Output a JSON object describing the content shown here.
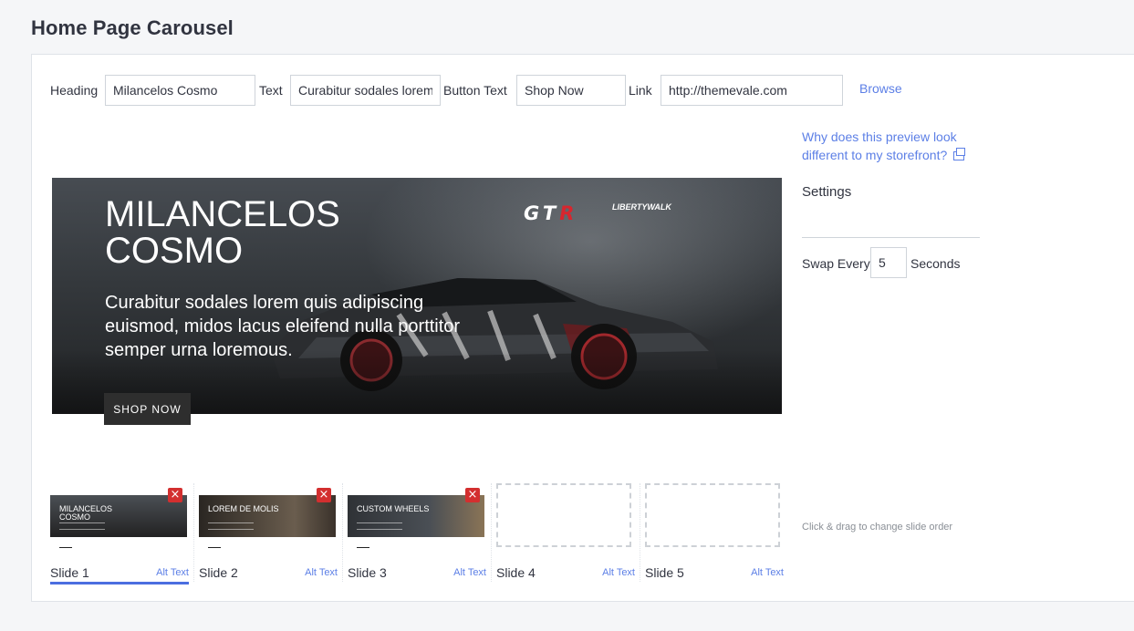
{
  "page": {
    "title": "Home Page Carousel"
  },
  "form": {
    "heading_label": "Heading",
    "heading_value": "Milancelos Cosmo",
    "text_label": "Text",
    "text_value": "Curabitur sodales lorem quis adipiscing",
    "button_text_label": "Button Text",
    "button_text_value": "Shop Now",
    "link_label": "Link",
    "link_value": "http://themevale.com",
    "browse_label": "Browse"
  },
  "preview": {
    "heading": "MILANCELOS COSMO",
    "text": "Curabitur sodales lorem quis adipiscing euismod, midos lacus eleifend nulla porttitor semper urna loremous.",
    "button": "SHOP NOW",
    "logo_gt": "GT",
    "logo_r": "R",
    "logo_lw": "LIBERTYWALK"
  },
  "sidebar": {
    "why_link": "Why does this preview look different to my storefront?",
    "settings_title": "Settings",
    "swap_label": "Swap Every",
    "swap_value": "5",
    "seconds_label": "Seconds",
    "drag_hint": "Click & drag to change slide order"
  },
  "slides": [
    {
      "name": "Slide 1",
      "alt": "Alt Text",
      "caption": "MILANCELOS COSMO",
      "active": true,
      "empty": false
    },
    {
      "name": "Slide 2",
      "alt": "Alt Text",
      "caption": "LOREM DE MOLIS",
      "active": false,
      "empty": false
    },
    {
      "name": "Slide 3",
      "alt": "Alt Text",
      "caption": "CUSTOM WHEELS",
      "active": false,
      "empty": false
    },
    {
      "name": "Slide 4",
      "alt": "Alt Text",
      "empty": true
    },
    {
      "name": "Slide 5",
      "alt": "Alt Text",
      "empty": true
    }
  ],
  "colors": {
    "accent": "#5c7fe6",
    "active_bar": "#4b6ee0",
    "delete": "#d32f2f"
  },
  "icons": {
    "delete": "close-icon",
    "external": "external-link-icon"
  }
}
